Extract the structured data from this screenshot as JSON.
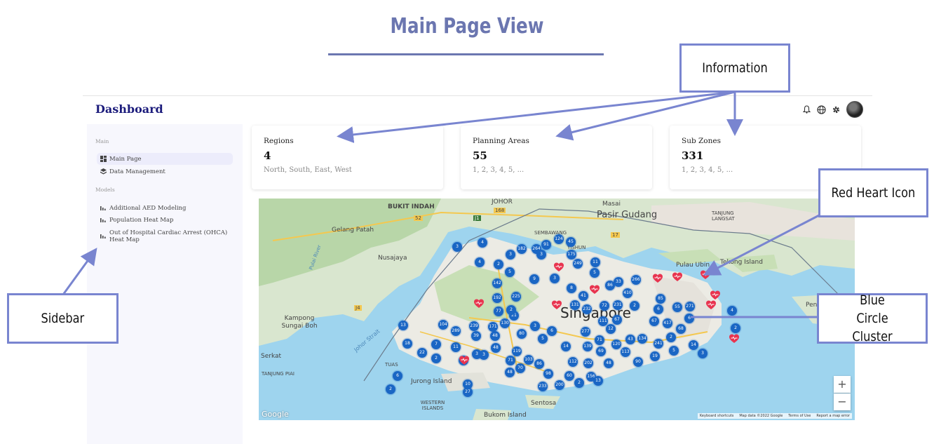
{
  "slide": {
    "title": "Main Page View"
  },
  "app": {
    "brand": "Dashboard",
    "header_icons": [
      "bell-icon",
      "globe-icon",
      "gear-icon",
      "avatar"
    ]
  },
  "sidebar": {
    "sections": [
      {
        "label": "Main"
      },
      {
        "label": "Models"
      }
    ],
    "items": [
      {
        "label": "Main Page",
        "icon": "grid-icon",
        "active": true
      },
      {
        "label": "Data Management",
        "icon": "layers-icon"
      },
      {
        "label": "Additional AED Modeling",
        "icon": "bar-chart-icon"
      },
      {
        "label": "Population Heat Map",
        "icon": "bar-chart-icon"
      },
      {
        "label": "Out of Hospital Cardiac Arrest (OHCA) Heat Map",
        "icon": "bar-chart-icon"
      }
    ]
  },
  "cards": [
    {
      "label": "Regions",
      "value": "4",
      "detail": "North, South, East, West"
    },
    {
      "label": "Planning Areas",
      "value": "55",
      "detail": "1, 2, 3, 4, 5, ..."
    },
    {
      "label": "Sub Zones",
      "value": "331",
      "detail": "1, 2, 3, 4, 5, ..."
    }
  ],
  "map": {
    "places": [
      "BUKIT INDAH",
      "JOHOR",
      "168",
      "Masai",
      "Pasir Gudang",
      "TANJUNG LANGSAT",
      "52",
      "J1",
      "J4",
      "17",
      "Gelang Patah",
      "Nusajaya",
      "SEMBAWANG",
      "YISHUN",
      "Pulau Ubin",
      "Tekong Island",
      "Kampong Sungai Boh",
      "Serkat",
      "TUAS",
      "TANJUNG PIAI",
      "Jurong Island",
      "WESTERN ISLANDS",
      "Sentosa",
      "Bukom Island",
      "Pengerang",
      "Singapore",
      "Johor Strait",
      "Pulai River"
    ],
    "clusters": [
      "4",
      "3",
      "182",
      "264",
      "91",
      "124",
      "45",
      "175",
      "249",
      "4",
      "2",
      "3",
      "5",
      "3",
      "11",
      "5",
      "3",
      "9",
      "142",
      "8",
      "86",
      "33",
      "266",
      "192",
      "225",
      "41",
      "410",
      "72",
      "231",
      "2",
      "85",
      "6",
      "77",
      "21",
      "131",
      "232",
      "111",
      "12",
      "67",
      "67",
      "417",
      "6",
      "4",
      "13",
      "104",
      "289",
      "239",
      "171",
      "130",
      "2",
      "3",
      "6",
      "277",
      "71",
      "43",
      "134",
      "241",
      "2",
      "68",
      "39",
      "48",
      "80",
      "5",
      "14",
      "139",
      "120",
      "113",
      "18",
      "22",
      "7",
      "11",
      "3",
      "48",
      "119",
      "103",
      "69",
      "19",
      "5",
      "14",
      "3",
      "2",
      "71",
      "70",
      "86",
      "112",
      "202",
      "48",
      "90",
      "3",
      "1",
      "48",
      "98",
      "60",
      "156",
      "13",
      "6",
      "2",
      "10",
      "27",
      "233",
      "200",
      "2",
      "271",
      "55",
      "2"
    ],
    "zoom_in": "+",
    "zoom_out": "−",
    "brand_mark": "Google",
    "attribution": [
      "Keyboard shortcuts",
      "Map data ©2022 Google",
      "Terms of Use",
      "Report a map error"
    ],
    "accent_colors": {
      "cluster": "#1a66c4",
      "heart": "#e8344f"
    }
  },
  "annotations": {
    "information": "Information",
    "red_heart_icon": "Red Heart Icon",
    "sidebar": "Sidebar",
    "blue_circle_cluster": "Blue Circle Cluster"
  }
}
